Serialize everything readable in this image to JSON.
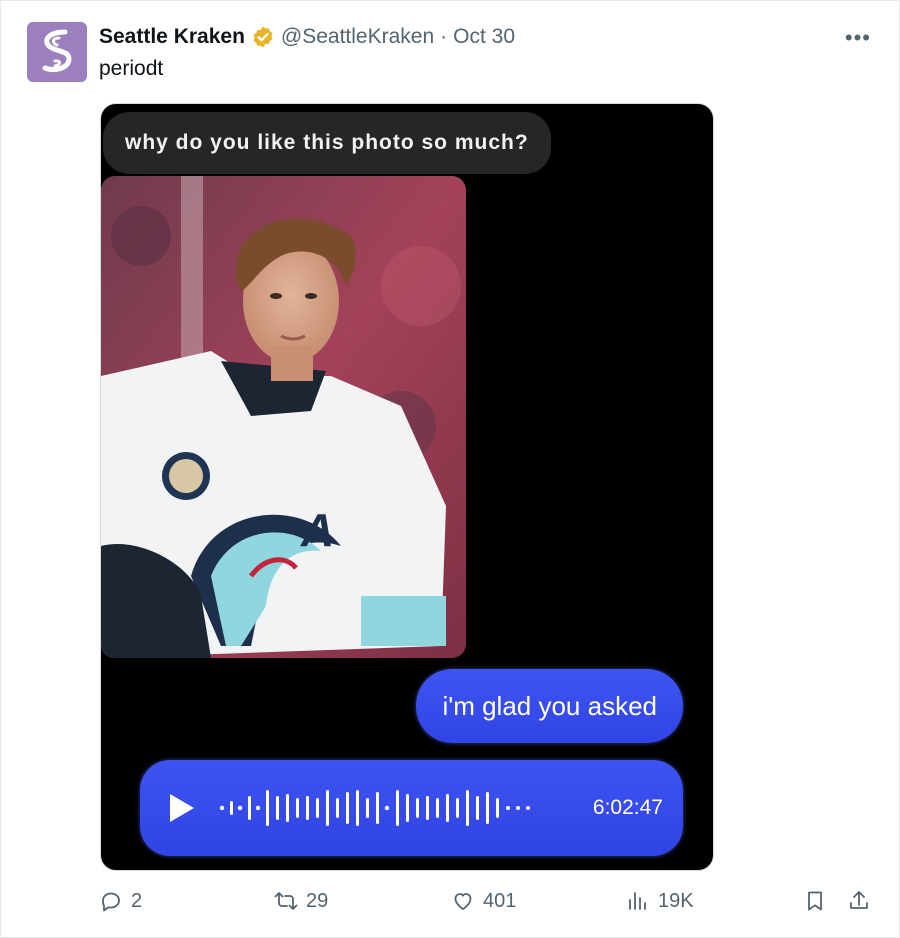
{
  "tweet": {
    "author_name": "Seattle Kraken",
    "handle": "@SeattleKraken",
    "separator": "·",
    "date": "Oct 30",
    "text": "periodt",
    "more_icon": "more-horizontal-icon",
    "verified_color": "#e8b52a"
  },
  "media": {
    "incoming_message": "why do you like this photo so much?",
    "outgoing_message": "i'm glad you asked",
    "voice_message": {
      "duration": "6:02:47",
      "play_icon": "play-icon",
      "waveform_icon": "waveform-icon"
    },
    "bubble_color": "#3a4ef0"
  },
  "actions": {
    "reply_count": "2",
    "retweet_count": "29",
    "like_count": "401",
    "view_count": "19K"
  }
}
